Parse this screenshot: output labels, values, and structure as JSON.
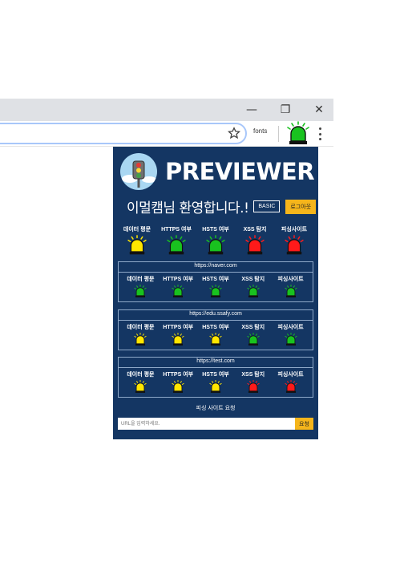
{
  "window_controls": {
    "minimize": "—",
    "restore": "❐",
    "close": "✕"
  },
  "toolbar": {
    "fonts_label": "fonts"
  },
  "popup": {
    "brand": "PREVIEWER",
    "welcome": "이멀캠님 환영합니다.!",
    "basic_label": "BASIC",
    "logout_label": "로그아웃",
    "columns": [
      "데이터 평문",
      "HTTPS 여부",
      "HSTS 여부",
      "XSS 탐지",
      "피싱사이트"
    ],
    "overall_status": [
      "yellow",
      "green",
      "green",
      "red",
      "red"
    ],
    "sites": [
      {
        "url": "https://naver.com",
        "status": [
          "green",
          "green",
          "green",
          "green",
          "green"
        ]
      },
      {
        "url": "https://edu.ssafy.com",
        "status": [
          "yellow",
          "yellow",
          "yellow",
          "green",
          "green"
        ]
      },
      {
        "url": "https://test.com",
        "status": [
          "yellow",
          "yellow",
          "yellow",
          "red",
          "red"
        ]
      }
    ],
    "request_title": "피싱 사이트 요청",
    "request_placeholder": "URL을 입력하세요.",
    "request_button": "요청"
  },
  "colors": {
    "popup_bg": "#143663",
    "accent": "#f5b51b",
    "siren_yellow": "#ffe600",
    "siren_green": "#19c21f",
    "siren_red": "#ff1a1a"
  }
}
